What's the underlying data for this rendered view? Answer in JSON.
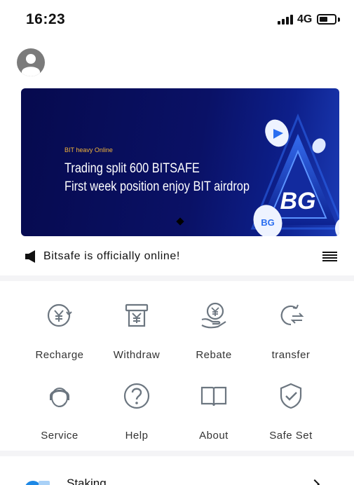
{
  "status_bar": {
    "time": "16:23",
    "network": "4G",
    "battery_level": 0.55
  },
  "header": {
    "avatar_icon": "user-avatar-icon"
  },
  "banner": {
    "tag": "BIT heavy Online",
    "line1": "Trading split 600 BITSAFE",
    "line2": "First week position enjoy BIT airdrop",
    "logo_text": "BG",
    "colors": {
      "background": "#0a1166",
      "tag": "#f2b53a",
      "accent": "#4a8cff"
    }
  },
  "notice": {
    "icon": "speaker-icon",
    "text": "Bitsafe is officially online!",
    "menu_icon": "menu-icon"
  },
  "quick_actions": [
    {
      "label": "Recharge",
      "icon": "recharge-yen-icon"
    },
    {
      "label": "Withdraw",
      "icon": "withdraw-icon"
    },
    {
      "label": "Rebate",
      "icon": "rebate-hand-icon"
    },
    {
      "label": "transfer",
      "icon": "transfer-icon"
    },
    {
      "label": "Service",
      "icon": "service-agent-icon"
    },
    {
      "label": "Help",
      "icon": "help-question-icon"
    },
    {
      "label": "About",
      "icon": "about-book-icon"
    },
    {
      "label": "Safe Set",
      "icon": "shield-check-icon"
    }
  ],
  "staking": {
    "label": "Staking",
    "icon": "staking-icon",
    "chevron": "chevron-right-icon"
  },
  "theme": {
    "icon_color": "#6c7680",
    "divider": "#f4f4f6",
    "accent_blue": "#1e88e5"
  }
}
